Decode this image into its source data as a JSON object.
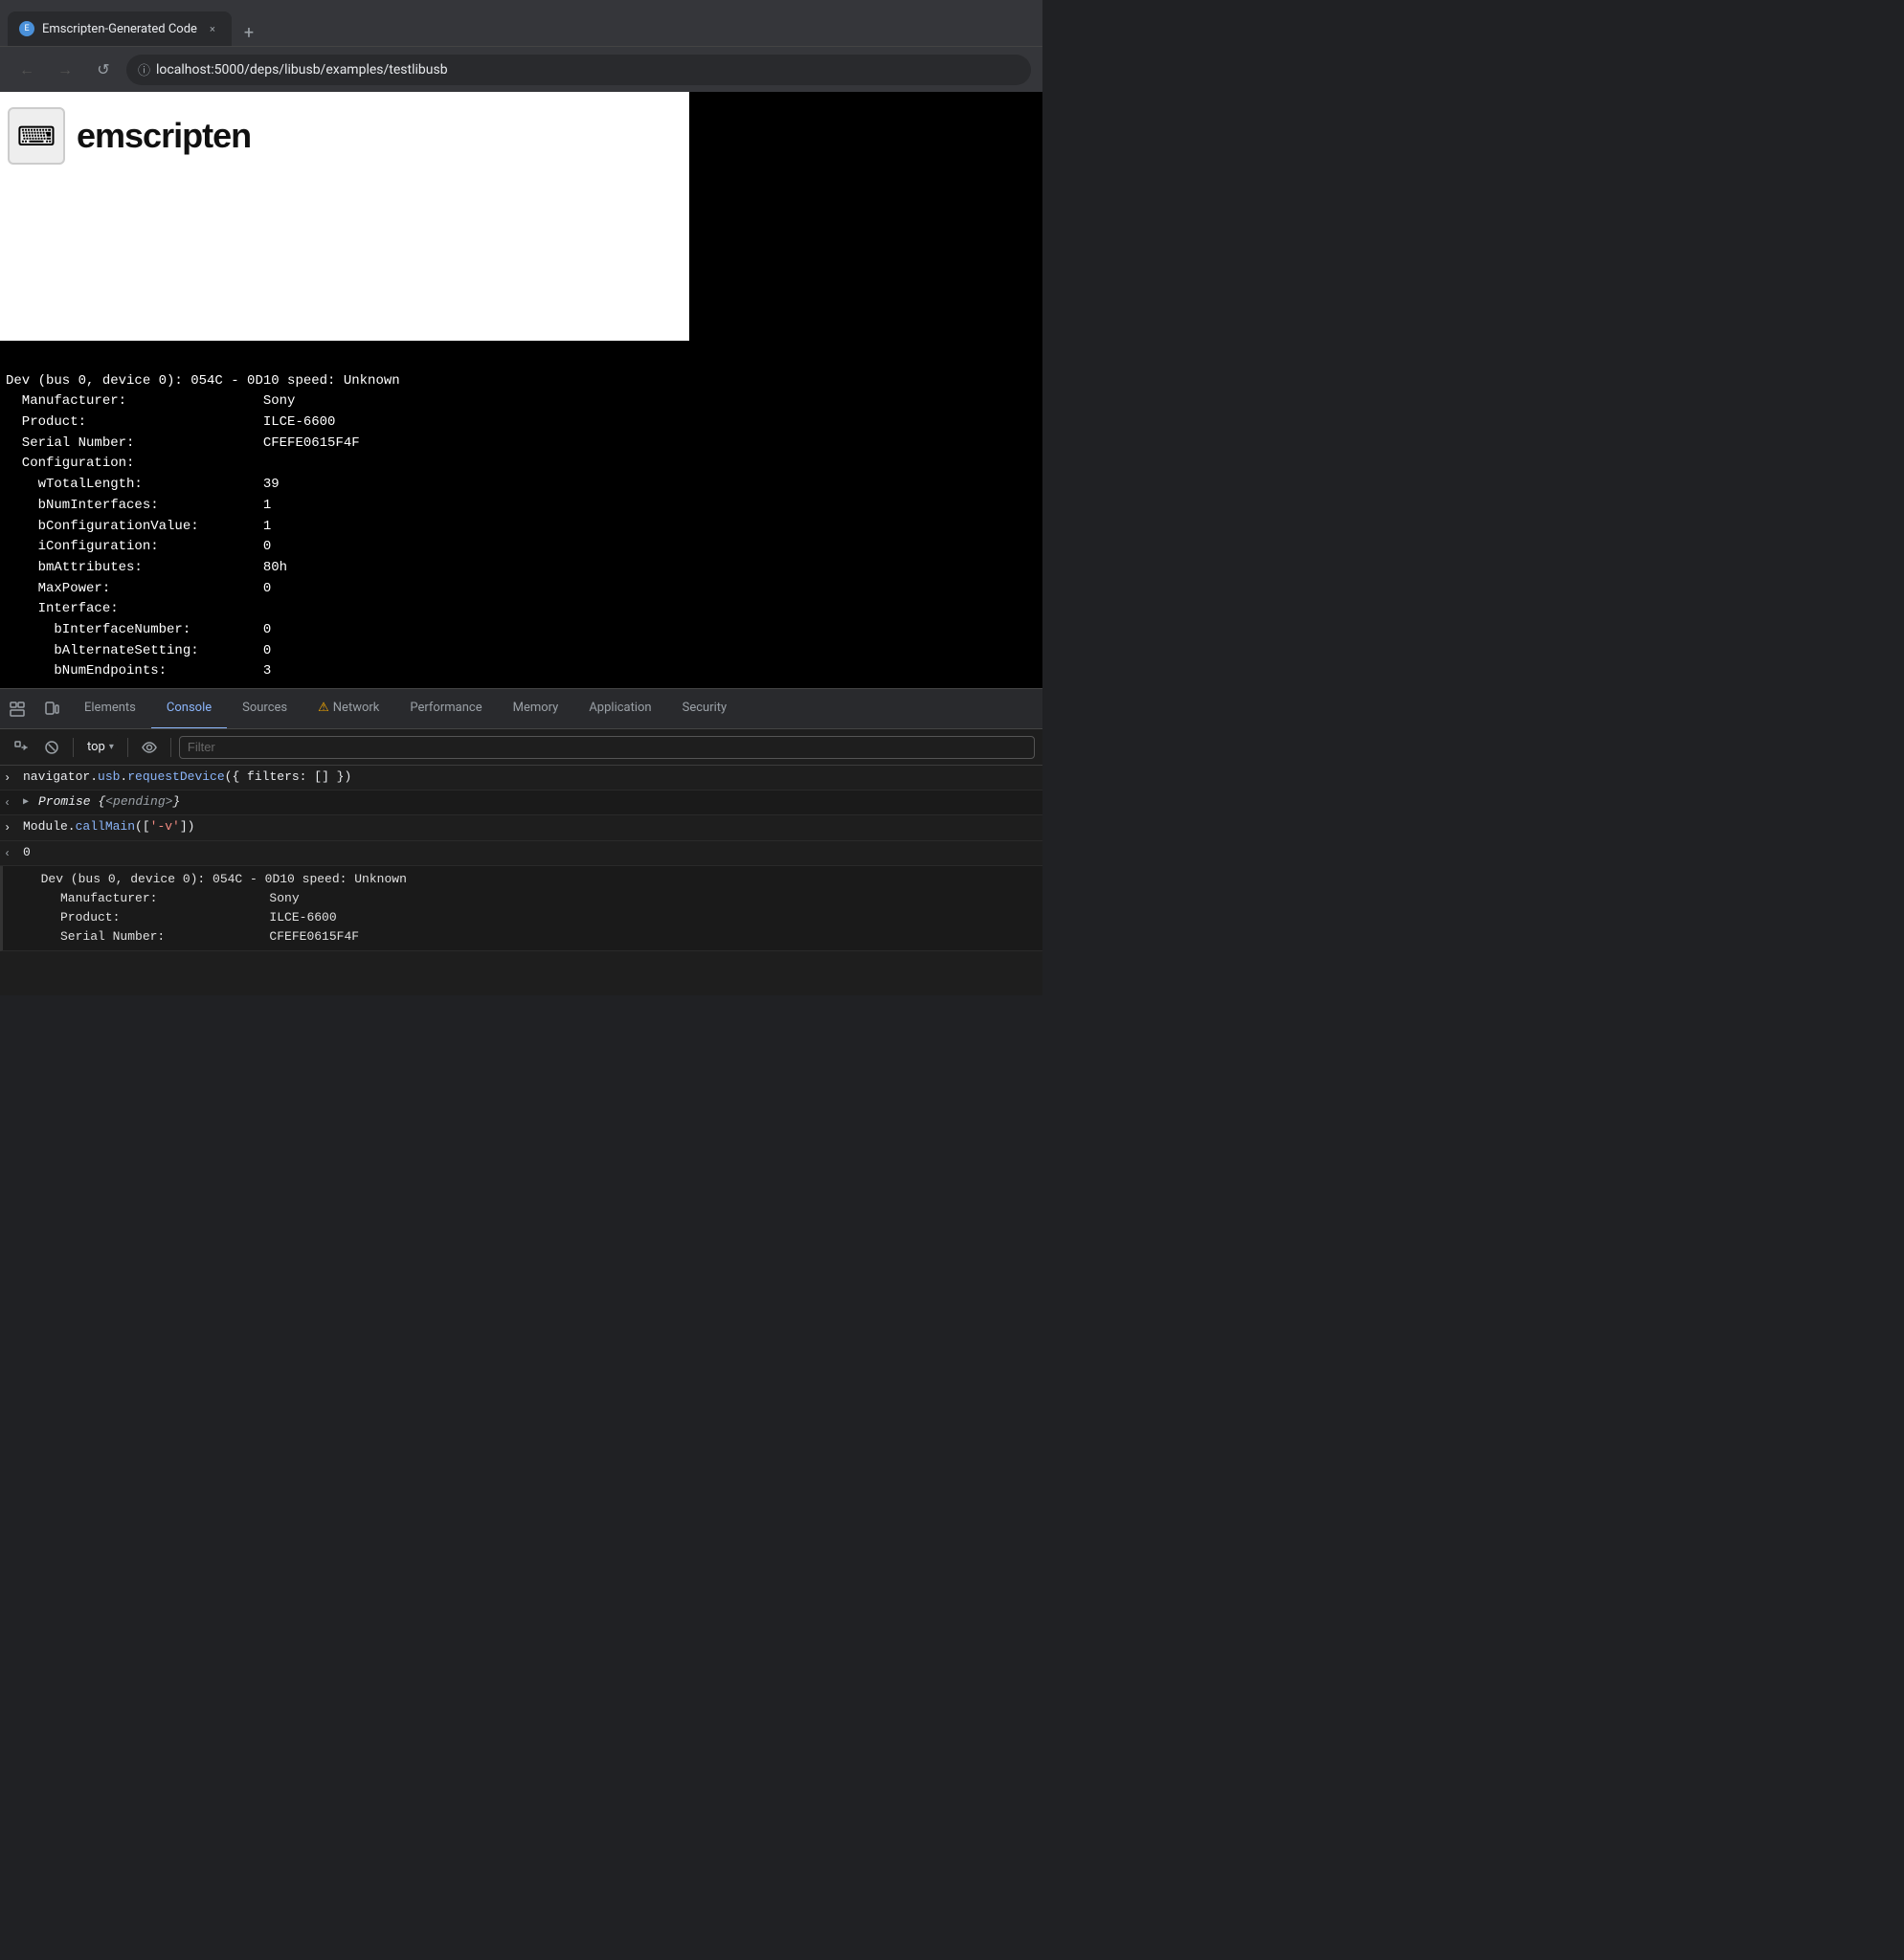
{
  "browser": {
    "tab": {
      "favicon_label": "E",
      "title": "Emscripten-Generated Code",
      "close_label": "×"
    },
    "new_tab_label": "+",
    "nav": {
      "back_label": "←",
      "forward_label": "→",
      "reload_label": "↺",
      "url_icon": "ⓘ",
      "url": "localhost:5000/deps/libusb/examples/testlibusb",
      "url_prefix": "localhost",
      "url_path": ":5000/deps/libusb/examples/testlibusb"
    }
  },
  "page": {
    "logo_text": "⌨",
    "title": "emscripten"
  },
  "terminal": {
    "lines": [
      "Dev (bus 0, device 0): 054C - 0D10 speed: Unknown",
      "  Manufacturer:                 Sony",
      "  Product:                      ILCE-6600",
      "  Serial Number:                CFEFE0615F4F",
      "  Configuration:",
      "    wTotalLength:               39",
      "    bNumInterfaces:             1",
      "    bConfigurationValue:        1",
      "    iConfiguration:             0",
      "    bmAttributes:               80h",
      "    MaxPower:                   0",
      "    Interface:",
      "      bInterfaceNumber:         0",
      "      bAlternateSetting:        0",
      "      bNumEndpoints:            3"
    ]
  },
  "devtools": {
    "tabs": [
      {
        "label": "Elements",
        "active": false,
        "warning": false
      },
      {
        "label": "Console",
        "active": true,
        "warning": false
      },
      {
        "label": "Sources",
        "active": false,
        "warning": false
      },
      {
        "label": "Network",
        "active": false,
        "warning": true
      },
      {
        "label": "Performance",
        "active": false,
        "warning": false
      },
      {
        "label": "Memory",
        "active": false,
        "warning": false
      },
      {
        "label": "Application",
        "active": false,
        "warning": false
      },
      {
        "label": "Security",
        "active": false,
        "warning": false
      }
    ],
    "toolbar": {
      "run_label": "▶",
      "stop_label": "⊘",
      "context_label": "top",
      "context_arrow": "▾",
      "eye_label": "👁",
      "filter_placeholder": "Filter"
    },
    "console": {
      "entries": [
        {
          "type": "input",
          "arrow": "›",
          "code": "navigator.usb.requestDevice({ filters: [] })"
        },
        {
          "type": "output",
          "arrow": "‹",
          "expandable": true,
          "code": "Promise {<pending>}"
        },
        {
          "type": "input",
          "arrow": "›",
          "code": "Module.callMain(['-v'])"
        },
        {
          "type": "return",
          "arrow": "‹",
          "code": "0"
        }
      ],
      "output_block": {
        "lines": [
          "  Dev (bus 0, device 0): 054C - 0D10 speed: Unknown",
          "    Manufacturer:               Sony",
          "    Product:                    ILCE-6600",
          "    Serial Number:              CFEFE0615F4F"
        ]
      }
    }
  }
}
